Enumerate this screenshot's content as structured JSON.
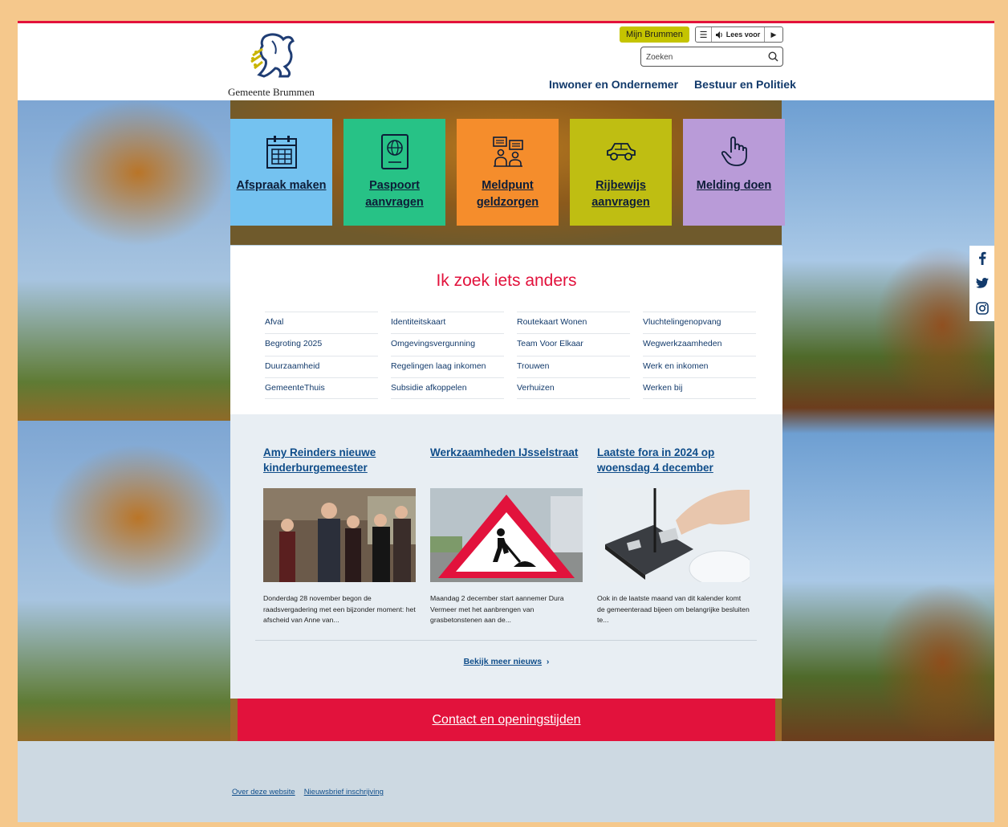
{
  "brand": {
    "name": "Gemeente Brummen",
    "accent_color": "#e2123c",
    "nav_color": "#123a6b"
  },
  "header": {
    "mijn_label": "Mijn Brummen",
    "read_aloud_label": "Lees voor",
    "search_placeholder": "Zoeken",
    "nav": [
      {
        "label": "Inwoner en Ondernemer"
      },
      {
        "label": "Bestuur en Politiek"
      }
    ]
  },
  "tiles": [
    {
      "label": "Afspraak maken",
      "icon": "calendar-icon",
      "color": "#74c2f0"
    },
    {
      "label": "Paspoort aanvragen",
      "icon": "passport-icon",
      "color": "#27c286"
    },
    {
      "label": "Meldpunt geldzorgen",
      "icon": "people-chat-icon",
      "color": "#f58d2c"
    },
    {
      "label": "Rijbewijs aanvragen",
      "icon": "car-icon",
      "color": "#bfbe12"
    },
    {
      "label": "Melding doen",
      "icon": "hand-pointer-icon",
      "color": "#b99bd8"
    }
  ],
  "search_other": {
    "title": "Ik zoek iets anders",
    "columns": [
      [
        "Afval",
        "Begroting 2025",
        "Duurzaamheid",
        "GemeenteThuis"
      ],
      [
        "Identiteitskaart",
        "Omgevingsvergunning",
        "Regelingen laag inkomen",
        "Subsidie afkoppelen"
      ],
      [
        "Routekaart Wonen",
        "Team Voor Elkaar",
        "Trouwen",
        "Verhuizen"
      ],
      [
        "Vluchtelingenopvang",
        "Wegwerkzaamheden",
        "Werk en inkomen",
        "Werken bij"
      ]
    ]
  },
  "news": {
    "items": [
      {
        "title": "Amy Reinders nieuwe kinderburgemeester",
        "text": "Donderdag 28 november begon de raadsvergadering met een bijzonder moment: het afscheid van Anne van..."
      },
      {
        "title": "Werkzaamheden IJsselstraat",
        "text": "Maandag 2 december start aannemer Dura Vermeer met het aanbrengen van grasbetonstenen aan de..."
      },
      {
        "title": "Laatste fora in 2024 op woensdag 4 december",
        "text": "Ook in de laatste maand van dit kalender komt de gemeenteraad bijeen om belangrijke besluiten te..."
      }
    ],
    "more_label": "Bekijk meer nieuws"
  },
  "contact": {
    "label": "Contact en openingstijden"
  },
  "social": [
    "facebook-icon",
    "twitter-icon",
    "instagram-icon"
  ],
  "footer": {
    "links": [
      "Over deze website",
      "Nieuwsbrief inschrijving"
    ]
  }
}
